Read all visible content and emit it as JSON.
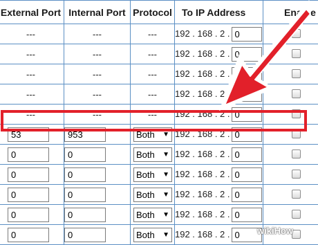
{
  "headers": {
    "external_port": "External Port",
    "internal_port": "Internal Port",
    "protocol": "Protocol",
    "to_ip": "To IP Address",
    "enable": "Enable"
  },
  "rows": [
    {
      "kind": "empty",
      "external": "---",
      "internal": "---",
      "protocol": "---",
      "ip_prefix": "192 . 168 . 2 .",
      "ip_last": "0",
      "enabled": false
    },
    {
      "kind": "empty",
      "external": "---",
      "internal": "---",
      "protocol": "---",
      "ip_prefix": "192 . 168 . 2 .",
      "ip_last": "0",
      "enabled": false
    },
    {
      "kind": "empty",
      "external": "---",
      "internal": "---",
      "protocol": "---",
      "ip_prefix": "192 . 168 . 2 .",
      "ip_last": "0",
      "enabled": false
    },
    {
      "kind": "empty",
      "external": "---",
      "internal": "---",
      "protocol": "---",
      "ip_prefix": "192 . 168 . 2 .",
      "ip_last": "0",
      "enabled": false
    },
    {
      "kind": "empty",
      "external": "---",
      "internal": "---",
      "protocol": "---",
      "ip_prefix": "192 . 168 . 2 .",
      "ip_last": "0",
      "enabled": false
    },
    {
      "kind": "editable",
      "external": "53",
      "internal": "953",
      "protocol": "Both",
      "ip_prefix": "192 . 168 . 2 .",
      "ip_last": "0",
      "enabled": false,
      "highlighted": true
    },
    {
      "kind": "editable",
      "external": "0",
      "internal": "0",
      "protocol": "Both",
      "ip_prefix": "192 . 168 . 2 .",
      "ip_last": "0",
      "enabled": false
    },
    {
      "kind": "editable",
      "external": "0",
      "internal": "0",
      "protocol": "Both",
      "ip_prefix": "192 . 168 . 2 .",
      "ip_last": "0",
      "enabled": false
    },
    {
      "kind": "editable",
      "external": "0",
      "internal": "0",
      "protocol": "Both",
      "ip_prefix": "192 . 168 . 2 .",
      "ip_last": "0",
      "enabled": false
    },
    {
      "kind": "editable",
      "external": "0",
      "internal": "0",
      "protocol": "Both",
      "ip_prefix": "192 . 168 . 2 .",
      "ip_last": "0",
      "enabled": false
    },
    {
      "kind": "editable",
      "external": "0",
      "internal": "0",
      "protocol": "Both",
      "ip_prefix": "192 . 168 . 2 .",
      "ip_last": "0",
      "enabled": false
    }
  ],
  "protocol_caret": "▼",
  "overlays": {
    "highlight_color": "#e2202a",
    "arrow_color": "#e2202a",
    "arrow_icon": "pointer-arrow-icon"
  },
  "watermark": "wikiHow"
}
